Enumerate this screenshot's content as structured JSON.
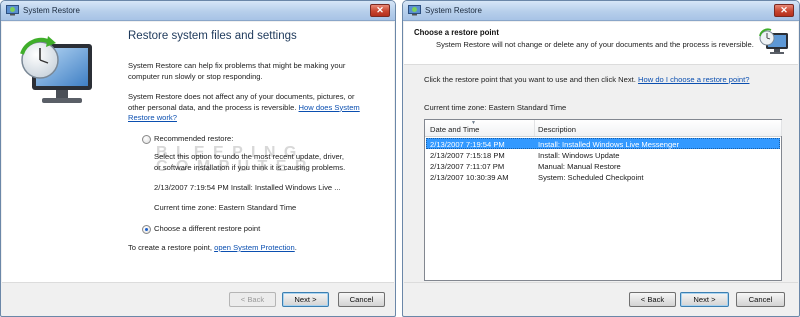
{
  "left_window": {
    "title": "System Restore",
    "heading": "Restore system files and settings",
    "intro": [
      "System Restore can help fix problems that might be making your",
      "computer run slowly or stop responding."
    ],
    "note_prefix": [
      "System Restore does not affect any of your documents, pictures, or",
      "other personal data, and the process is reversible. "
    ],
    "note_link": [
      "How does System",
      "Restore work?"
    ],
    "recommended_label": "Recommended restore:",
    "recommended_desc": [
      "Select this option to undo the most recent update, driver,",
      "or software installation if you think it is causing problems."
    ],
    "recommended_point": "2/13/2007 7:19:54 PM Install: Installed Windows Live ...",
    "current_time_zone": "Current time zone: Eastern Standard Time",
    "choose_different_label": "Choose a different restore point",
    "create_prefix": "To create a restore point, ",
    "create_link": "open System Protection",
    "create_suffix": ".",
    "watermark": [
      "B L E E P I N G",
      "C O M P U T E R"
    ],
    "buttons": {
      "back": "< Back",
      "next": "Next >",
      "cancel": "Cancel"
    }
  },
  "right_window": {
    "title": "System Restore",
    "header_title": "Choose a restore point",
    "header_subtitle": "System Restore will not change or delete any of your documents and the process is reversible.",
    "instruction": "Click the restore point that you want to use and then click Next.",
    "instruction_link": "How do I choose a restore point?",
    "current_time_zone": "Current time zone: Eastern Standard Time",
    "columns": [
      "Date and Time",
      "Description"
    ],
    "rows": [
      {
        "date": "2/13/2007 7:19:54 PM",
        "description": "Install: Installed Windows Live Messenger",
        "selected": true
      },
      {
        "date": "2/13/2007 7:15:18 PM",
        "description": "Install: Windows Update",
        "selected": false
      },
      {
        "date": "2/13/2007 7:11:07 PM",
        "description": "Manual: Manual Restore",
        "selected": false
      },
      {
        "date": "2/13/2007 10:30:39 AM",
        "description": "System: Scheduled Checkpoint",
        "selected": false
      }
    ],
    "buttons": {
      "back": "< Back",
      "next": "Next >",
      "cancel": "Cancel"
    }
  },
  "icons": [
    "system-restore-icon",
    "close-icon",
    "restore-clock-monitor-icon",
    "sort-arrow-icon"
  ],
  "colors": {
    "selection": "#3399ff",
    "link": "#0b4fb0",
    "heading": "#1e395b",
    "close_button": "#c8452f"
  }
}
